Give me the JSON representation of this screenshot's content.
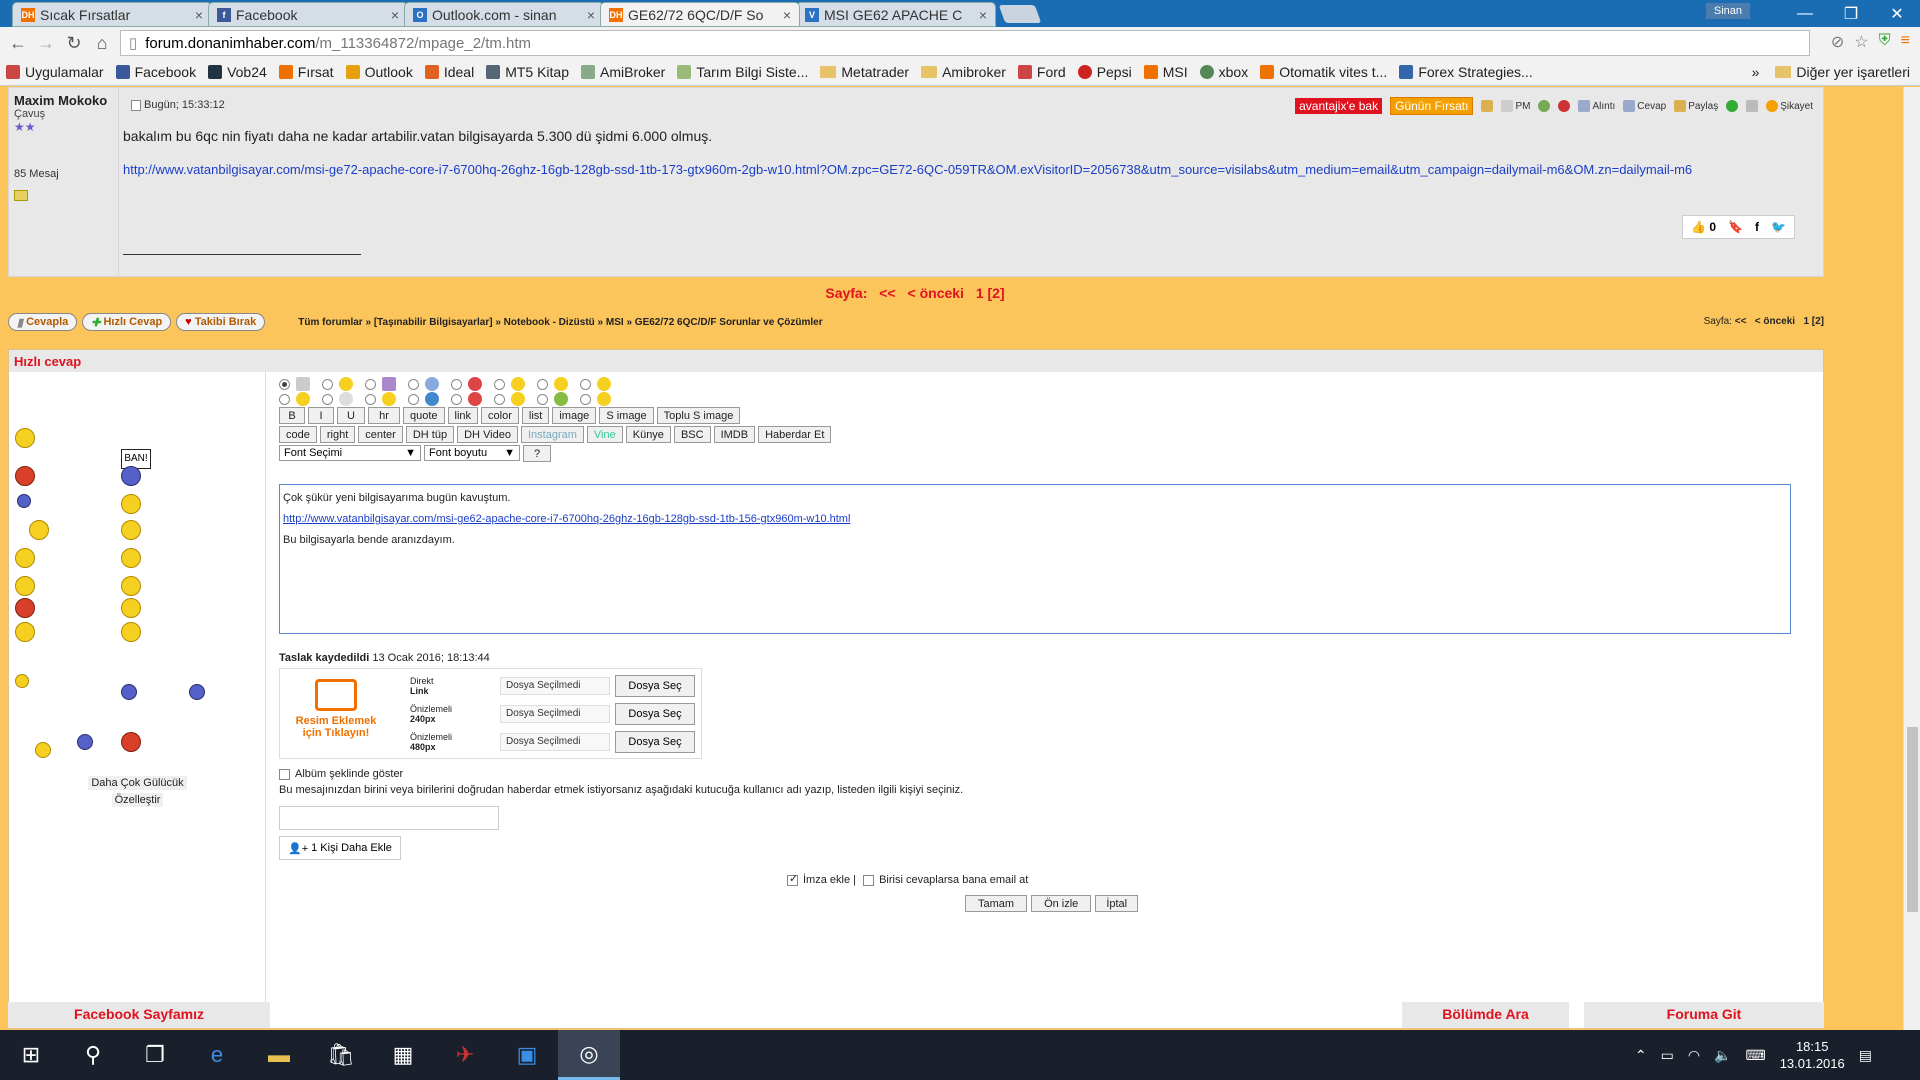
{
  "browser": {
    "tabs": [
      {
        "title": "Sıcak Fırsatlar",
        "icon": "dh-icon"
      },
      {
        "title": "Facebook",
        "icon": "facebook-icon"
      },
      {
        "title": "Outlook.com - sinan",
        "icon": "outlook-icon"
      },
      {
        "title": "GE62/72 6QC/D/F So",
        "icon": "dh-icon"
      },
      {
        "title": "MSI GE62 APACHE C",
        "icon": "v-icon"
      }
    ],
    "user": "Sinan",
    "url_host": "forum.donanimhaber.com",
    "url_path": "/m_113364872/mpage_2/tm.htm",
    "bookmarks": [
      "Uygulamalar",
      "Facebook",
      "Vob24",
      "Fırsat",
      "Outlook",
      "Ideal",
      "MT5 Kitap",
      "AmiBroker",
      "Tarım Bilgi Siste...",
      "Metatrader",
      "Amibroker",
      "Ford",
      "Pepsi",
      "MSI",
      "xbox",
      "Otomatik vites t...",
      "Forex Strategies..."
    ],
    "bookmarks_more": "»",
    "other_bookmarks": "Diğer yer işaretleri"
  },
  "post": {
    "author": "Maxim Mokoko",
    "rank": "Çavuş",
    "stars": "★★",
    "message_count": "85 Mesaj",
    "time": "Bugün; 15:33:12",
    "badge1": "avantajix'e bak",
    "badge2": "Günün Fırsatı",
    "actions": [
      "PM",
      "Alıntı",
      "Cevap",
      "Paylaş",
      "Şikayet"
    ],
    "text": "bakalım bu 6qc nin fiyatı daha ne kadar artabilir.vatan bilgisayarda 5.300 dü şidmi 6.000 olmuş.",
    "link": "http://www.vatanbilgisayar.com/msi-ge72-apache-core-i7-6700hq-26ghz-16gb-128gb-ssd-1tb-173-gtx960m-2gb-w10.html?OM.zpc=GE72-6QC-059TR&OM.exVisitorID=2056738&utm_source=visilabs&utm_medium=email&utm_campaign=dailymail-m6&OM.zn=dailymail-m6",
    "likes": "0"
  },
  "pager": {
    "label": "Sayfa:",
    "first": "<<",
    "prev": "< önceki",
    "pages": "1 [2]"
  },
  "nav": {
    "buttons": [
      "Cevapla",
      "Hızlı Cevap",
      "Takibi Bırak"
    ],
    "breadcrumb": "Tüm forumlar » [Taşınabilir Bilgisayarlar] » Notebook - Dizüstü » MSI » GE62/72 6QC/D/F Sorunlar ve Çözümler"
  },
  "quick_reply": {
    "title": "Hızlı cevap",
    "ban_label": "BAN!",
    "more_smileys": "Daha Çok Gülücük",
    "customize": "Özelleştir",
    "format_row1": [
      "B",
      "I",
      "U",
      "hr",
      "quote",
      "link",
      "color",
      "list",
      "image",
      "S image",
      "Toplu S image"
    ],
    "format_row2": [
      "code",
      "right",
      "center",
      "DH tüp",
      "DH Video",
      "Instagram",
      "Vine",
      "Künye",
      "BSC",
      "IMDB",
      "Haberdar Et"
    ],
    "font_select": "Font Seçimi",
    "size_select": "Font boyutu",
    "help": "?",
    "body_line1": "Çok şükür yeni bilgisayarıma bugün kavuştum.",
    "body_link": "http://www.vatanbilgisayar.com/msi-ge62-apache-core-i7-6700hq-26ghz-16gb-128gb-ssd-1tb-156-gtx960m-w10.html",
    "body_line3": "Bu bilgisayarla bende aranızdayım.",
    "draft_label": "Taslak kaydedildi",
    "draft_time": "13 Ocak 2016; 18:13:44",
    "upload_caption": "Resim Eklemek için Tıklayın!",
    "upload_rows": [
      {
        "l1": "Direkt",
        "l2": "Link"
      },
      {
        "l1": "Önizlemeli",
        "l2": "240px"
      },
      {
        "l1": "Önizlemeli",
        "l2": "480px"
      }
    ],
    "no_file": "Dosya Seçilmedi",
    "choose_file": "Dosya Seç",
    "album": "Albüm şeklinde göster",
    "mention_info": "Bu mesajınızdan birini veya birilerini doğrudan haberdar etmek istiyorsanız aşağıdaki kutucuğa kullanıcı adı yazıp, listeden ilgili kişiyi seçiniz.",
    "add_person": "1 Kişi Daha Ekle",
    "signature": "İmza ekle |",
    "email_notify": "Birisi cevaplarsa bana email at",
    "ok": "Tamam",
    "preview": "Ön izle",
    "cancel": "İptal"
  },
  "footer": {
    "left": "Facebook Sayfamız",
    "mid": "Bölümde Ara",
    "right": "Foruma Git"
  },
  "taskbar": {
    "time": "18:15",
    "date": "13.01.2016"
  }
}
